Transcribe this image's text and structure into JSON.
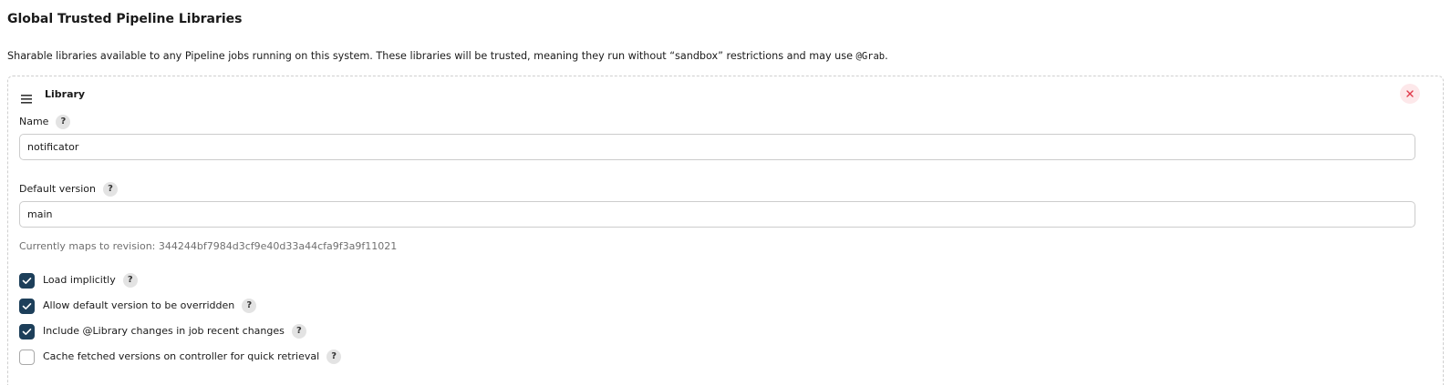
{
  "section": {
    "title": "Global Trusted Pipeline Libraries",
    "description_prefix": "Sharable libraries available to any Pipeline jobs running on this system. These libraries will be trusted, meaning they run without “sandbox” restrictions and may use ",
    "description_code": "@Grab",
    "description_suffix": "."
  },
  "library": {
    "title": "Library",
    "handle_icon": "drag-handle-icon",
    "close_icon": "close-icon",
    "help_glyph": "?",
    "name": {
      "label": "Name",
      "value": "notificator"
    },
    "default_version": {
      "label": "Default version",
      "value": "main",
      "revision_text": "Currently maps to revision: 344244bf7984d3cf9e40d33a44cfa9f3a9f11021"
    },
    "options": [
      {
        "label": "Load implicitly",
        "checked": true
      },
      {
        "label": "Allow default version to be overridden",
        "checked": true
      },
      {
        "label": "Include @Library changes in job recent changes",
        "checked": true
      },
      {
        "label": "Cache fetched versions on controller for quick retrieval",
        "checked": false
      }
    ]
  },
  "colors": {
    "checkbox_checked": "#1d3f5a",
    "close_accent": "#e0394a",
    "muted_text": "#707070"
  }
}
